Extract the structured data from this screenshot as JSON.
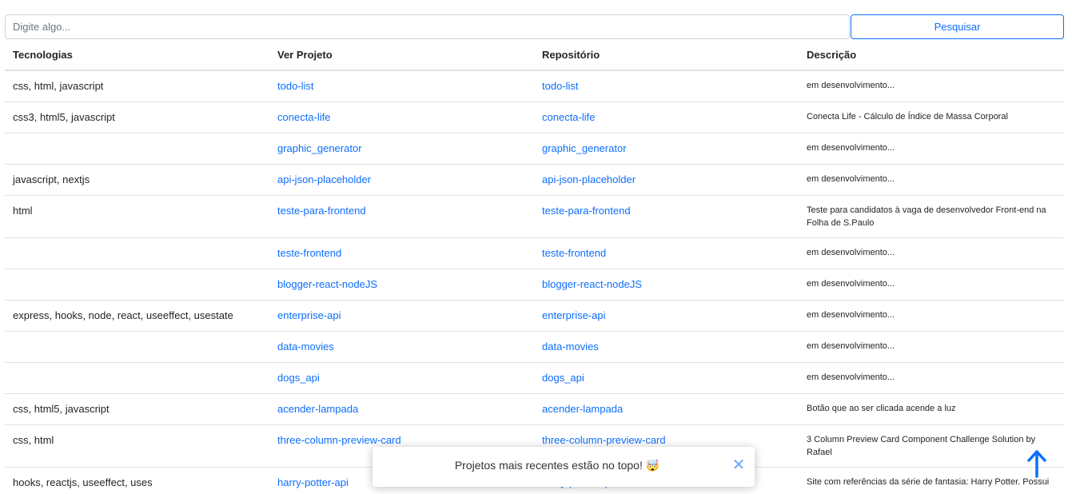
{
  "search": {
    "placeholder": "Digite algo...",
    "value": "",
    "button_label": "Pesquisar"
  },
  "table": {
    "headers": [
      "Tecnologias",
      "Ver Projeto",
      "Repositório",
      "Descrição"
    ],
    "rows": [
      {
        "tech": "css, html, javascript",
        "project": "todo-list",
        "repo": "todo-list",
        "desc": "em desenvolvimento..."
      },
      {
        "tech": "css3, html5, javascript",
        "project": "conecta-life",
        "repo": "conecta-life",
        "desc": "Conecta Life - Cálculo de Índice de Massa Corporal"
      },
      {
        "tech": "",
        "project": "graphic_generator",
        "repo": "graphic_generator",
        "desc": "em desenvolvimento..."
      },
      {
        "tech": "javascript, nextjs",
        "project": "api-json-placeholder",
        "repo": "api-json-placeholder",
        "desc": "em desenvolvimento..."
      },
      {
        "tech": "html",
        "project": "teste-para-frontend",
        "repo": "teste-para-frontend",
        "desc": "Teste para candidatos à vaga de desenvolvedor Front-end na Folha de S.Paulo"
      },
      {
        "tech": "",
        "project": "teste-frontend",
        "repo": "teste-frontend",
        "desc": "em desenvolvimento..."
      },
      {
        "tech": "",
        "project": "blogger-react-nodeJS",
        "repo": "blogger-react-nodeJS",
        "desc": "em desenvolvimento..."
      },
      {
        "tech": "express, hooks, node, react, useeffect, usestate",
        "project": "enterprise-api",
        "repo": "enterprise-api",
        "desc": "em desenvolvimento..."
      },
      {
        "tech": "",
        "project": "data-movies",
        "repo": "data-movies",
        "desc": "em desenvolvimento..."
      },
      {
        "tech": "",
        "project": "dogs_api",
        "repo": "dogs_api",
        "desc": "em desenvolvimento..."
      },
      {
        "tech": "css, html5, javascript",
        "project": "acender-lampada",
        "repo": "acender-lampada",
        "desc": "Botão que ao ser clicada acende a luz"
      },
      {
        "tech": "css, html",
        "project": "three-column-preview-card",
        "repo": "three-column-preview-card",
        "desc": "3 Column Preview Card Component Challenge Solution by Rafael"
      },
      {
        "tech": "hooks, reactjs, useeffect, uses",
        "project": "harry-potter-api",
        "repo": "harry-potter-api",
        "desc": "Site com referências da série de fantasia: Harry Potter. Possui"
      }
    ]
  },
  "toast": {
    "message": "Projetos mais recentes estão no topo! 🤯",
    "close_symbol": "✕"
  },
  "icons": {
    "scroll_top": "arrow-up-icon",
    "close": "close-icon"
  },
  "colors": {
    "accent": "#0d6efd",
    "close": "#6ea8fe",
    "border": "#dee2e6"
  }
}
